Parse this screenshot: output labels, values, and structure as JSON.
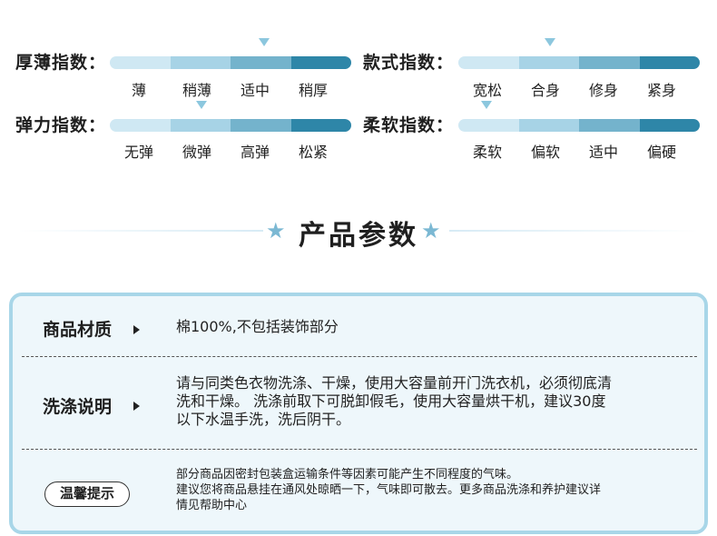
{
  "indices": [
    {
      "label": "厚薄指数：",
      "options": [
        "薄",
        "稍薄",
        "适中",
        "稍厚"
      ],
      "selected_index": 2
    },
    {
      "label": "款式指数：",
      "options": [
        "宽松",
        "合身",
        "修身",
        "紧身"
      ],
      "selected_index": 1
    },
    {
      "label": "弹力指数：",
      "options": [
        "无弹",
        "微弹",
        "高弹",
        "松紧"
      ],
      "selected_index": 1
    },
    {
      "label": "柔软指数：",
      "options": [
        "柔软",
        "偏软",
        "适中",
        "偏硬"
      ],
      "selected_index": 0
    }
  ],
  "section_title": "产品参数",
  "colors": {
    "bar_segments": [
      "#cfe8f3",
      "#a7d3e6",
      "#74b3cc",
      "#2e86a8"
    ],
    "marker": "#8cc7de",
    "panel_border": "#a8d6e8",
    "panel_bg": "#eef7fb",
    "star": "#7bb8d3"
  },
  "params": {
    "material": {
      "label": "商品材质",
      "value": "棉100%,不包括装饰部分"
    },
    "washing": {
      "label": "洗涤说明",
      "lines": [
        "请与同类色衣物洗涤、干燥，使用大容量前开门洗衣机，必须彻底清",
        "洗和干燥。 洗涤前取下可脱卸假毛，使用大容量烘干机，建议30度",
        "以下水温手洗，洗后阴干。"
      ]
    },
    "tips": {
      "label": "温馨提示",
      "lines": [
        "部分商品因密封包装盒运输条件等因素可能产生不同程度的气味。",
        "建议您将商品悬挂在通风处晾晒一下，气味即可散去。更多商品洗涤和养护建议详",
        "情见帮助中心"
      ]
    }
  }
}
